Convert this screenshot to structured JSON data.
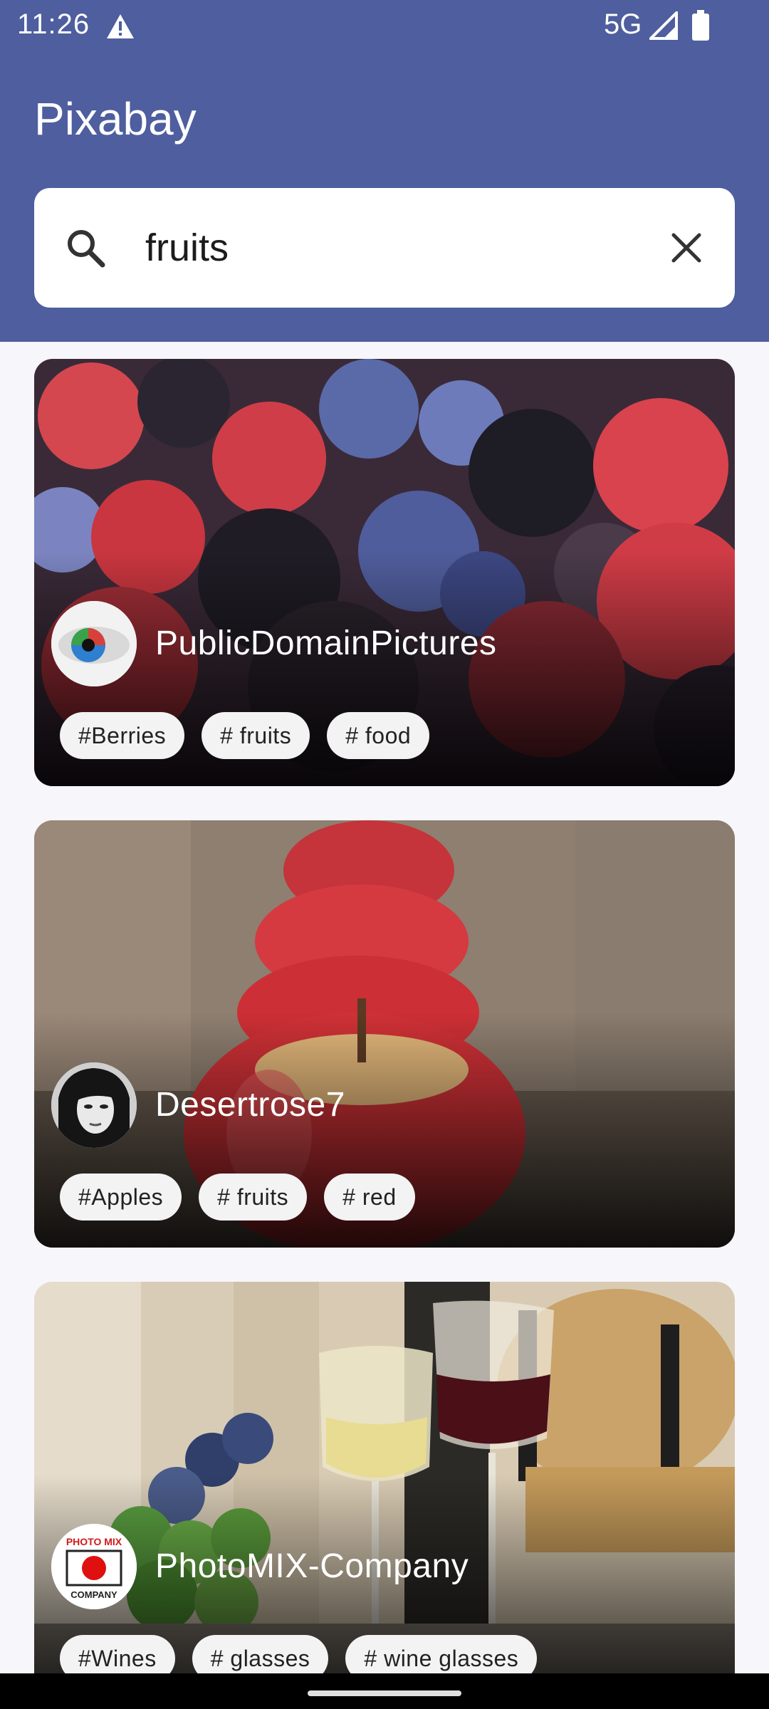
{
  "status_bar": {
    "time": "11:26",
    "network": "5G",
    "icons": [
      "warning-icon",
      "signal-icon",
      "battery-icon"
    ]
  },
  "app_bar": {
    "title": "Pixabay",
    "color": "#4e5e9e"
  },
  "search": {
    "value": "fruits",
    "placeholder": "",
    "icons": [
      "search-icon",
      "close-icon"
    ]
  },
  "cards": [
    {
      "author": "PublicDomainPictures",
      "tags": [
        "#Berries",
        "# fruits",
        "# food"
      ]
    },
    {
      "author": "Desertrose7",
      "tags": [
        "#Apples",
        "# fruits",
        "# red"
      ]
    },
    {
      "author": "PhotoMIX-Company",
      "avatar_text_top": "PHOTO MIX",
      "avatar_text_bottom": "COMPANY",
      "tags": [
        "#Wines",
        "# glasses",
        "# wine glasses"
      ]
    }
  ]
}
